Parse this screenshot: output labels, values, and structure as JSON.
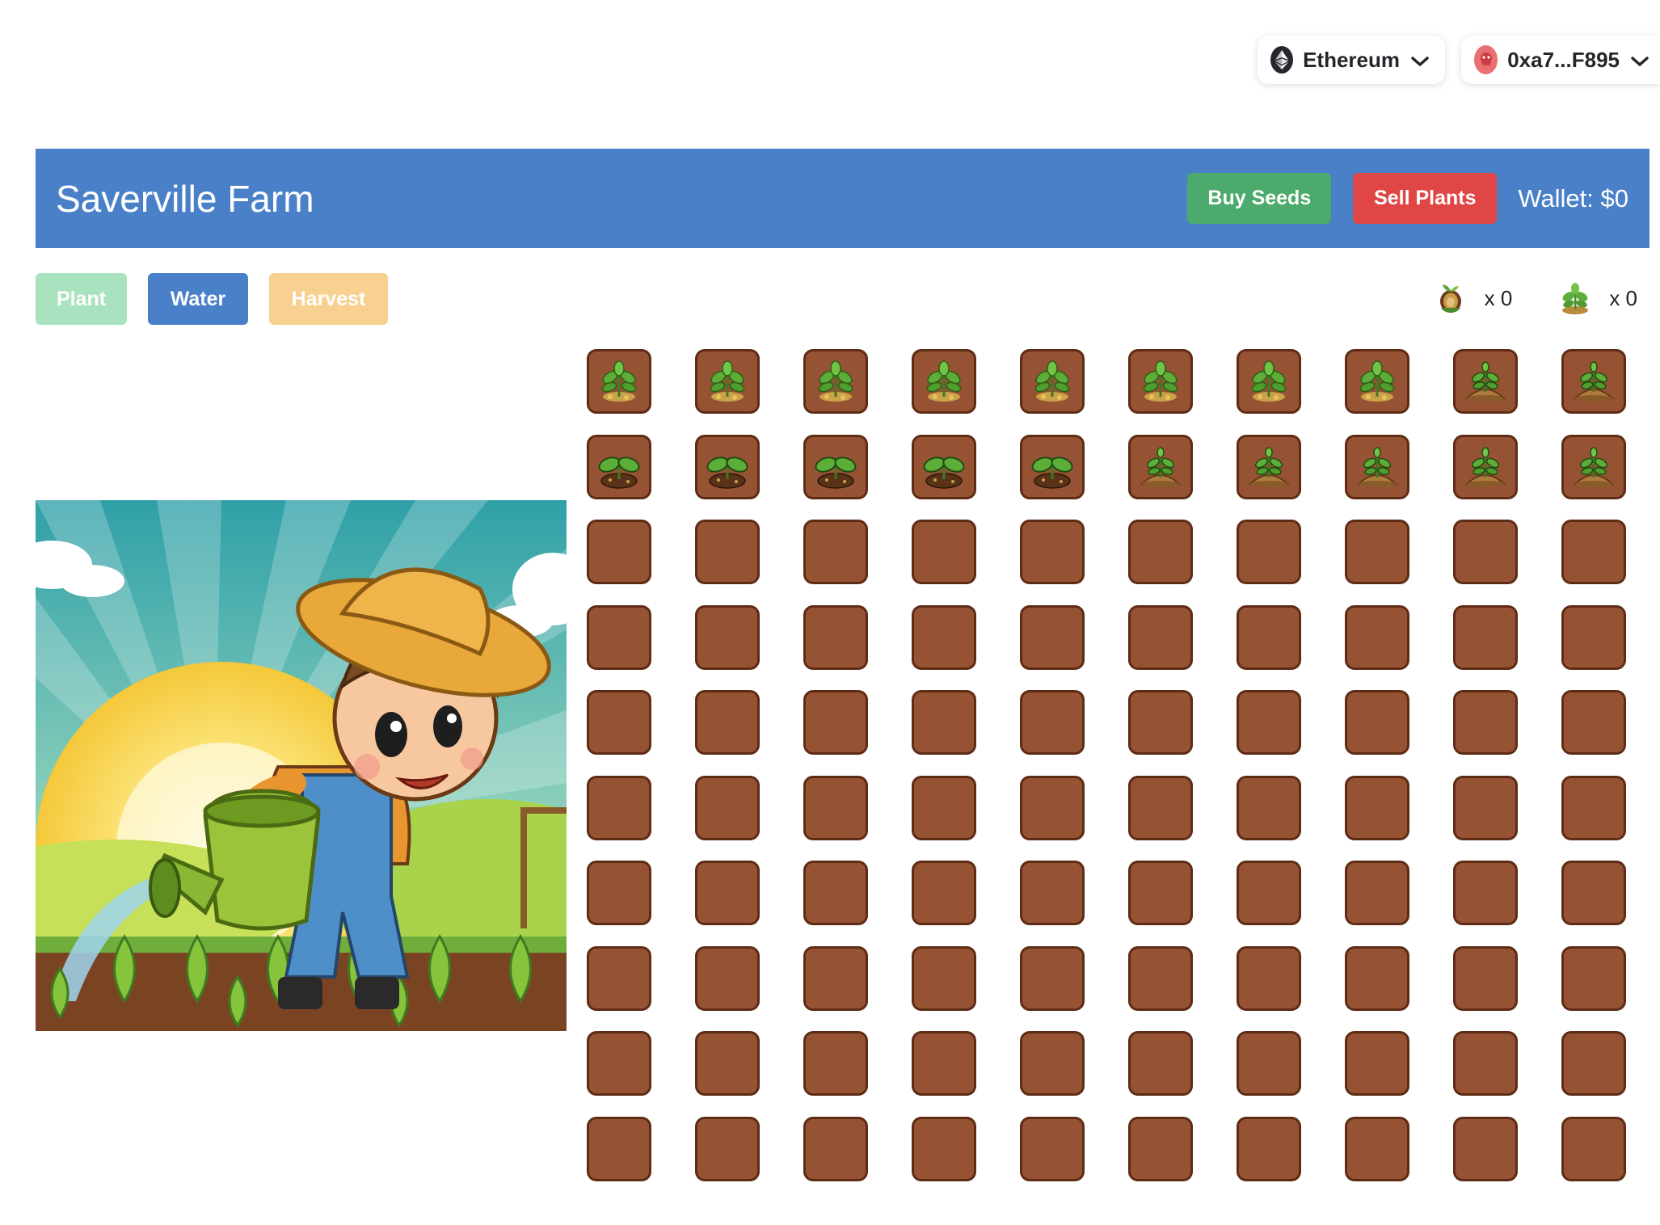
{
  "wallet_bar": {
    "network": "Ethereum",
    "network_icon": "ethereum-icon",
    "account": "0xa7...F895",
    "account_icon": "avatar-icon"
  },
  "header": {
    "title": "Saverville Farm",
    "buy_label": "Buy Seeds",
    "sell_label": "Sell Plants",
    "wallet_text": "Wallet: $0",
    "bg_color": "#4a80c7"
  },
  "tools": {
    "plant_label": "Plant",
    "water_label": "Water",
    "harvest_label": "Harvest"
  },
  "inventory": {
    "seeds_count": "x 0",
    "seeds_icon": "seed-icon",
    "plants_count": "x 0",
    "plants_icon": "plant-icon"
  },
  "illustration": {
    "subject": "farmer-watering-seedlings-image"
  },
  "farm": {
    "columns": 10,
    "rows": 10,
    "plot_states": [
      [
        "grown",
        "grown",
        "grown",
        "grown",
        "grown",
        "grown",
        "grown",
        "grown",
        "sprout",
        "sprout"
      ],
      [
        "seedling",
        "seedling",
        "seedling",
        "seedling",
        "seedling",
        "sprout",
        "sprout",
        "sprout",
        "sprout",
        "sprout"
      ],
      [
        "empty",
        "empty",
        "empty",
        "empty",
        "empty",
        "empty",
        "empty",
        "empty",
        "empty",
        "empty"
      ],
      [
        "empty",
        "empty",
        "empty",
        "empty",
        "empty",
        "empty",
        "empty",
        "empty",
        "empty",
        "empty"
      ],
      [
        "empty",
        "empty",
        "empty",
        "empty",
        "empty",
        "empty",
        "empty",
        "empty",
        "empty",
        "empty"
      ],
      [
        "empty",
        "empty",
        "empty",
        "empty",
        "empty",
        "empty",
        "empty",
        "empty",
        "empty",
        "empty"
      ],
      [
        "empty",
        "empty",
        "empty",
        "empty",
        "empty",
        "empty",
        "empty",
        "empty",
        "empty",
        "empty"
      ],
      [
        "empty",
        "empty",
        "empty",
        "empty",
        "empty",
        "empty",
        "empty",
        "empty",
        "empty",
        "empty"
      ],
      [
        "empty",
        "empty",
        "empty",
        "empty",
        "empty",
        "empty",
        "empty",
        "empty",
        "empty",
        "empty"
      ],
      [
        "empty",
        "empty",
        "empty",
        "empty",
        "empty",
        "empty",
        "empty",
        "empty",
        "empty",
        "empty"
      ]
    ],
    "soil_color": "#965334"
  }
}
